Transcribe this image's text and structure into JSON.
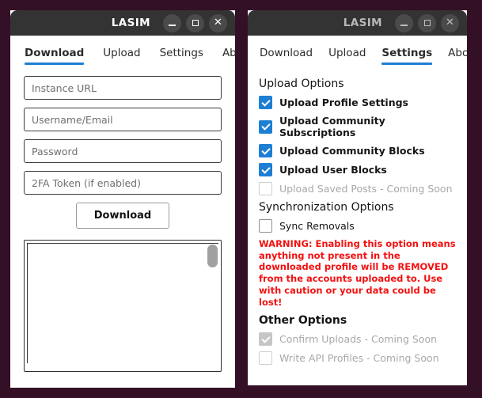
{
  "desktop": {
    "background_color": "#341026"
  },
  "download_window": {
    "titlebar": {
      "title": "LASIM",
      "minimize_label": "Minimize",
      "maximize_label": "Maximize",
      "close_label": "Close"
    },
    "tabs": [
      {
        "label": "Download",
        "active": true
      },
      {
        "label": "Upload",
        "active": false
      },
      {
        "label": "Settings",
        "active": false
      },
      {
        "label": "About",
        "active": false
      }
    ],
    "fields": [
      {
        "name": "instance-url",
        "placeholder": "Instance URL",
        "value": ""
      },
      {
        "name": "username-email",
        "placeholder": "Username/Email",
        "value": ""
      },
      {
        "name": "password",
        "placeholder": "Password",
        "value": ""
      },
      {
        "name": "twofa-token",
        "placeholder": "2FA Token (if enabled)",
        "value": ""
      }
    ],
    "download_button": "Download",
    "log_output": ""
  },
  "settings_window": {
    "titlebar": {
      "title": "LASIM",
      "minimize_label": "Minimize",
      "maximize_label": "Maximize",
      "close_label": "Close"
    },
    "tabs": [
      {
        "label": "Download",
        "active": false
      },
      {
        "label": "Upload",
        "active": false
      },
      {
        "label": "Settings",
        "active": true
      },
      {
        "label": "About",
        "active": false
      }
    ],
    "upload_options": {
      "title": "Upload Options",
      "items": [
        {
          "label": "Upload Profile Settings",
          "checked": true,
          "disabled": false
        },
        {
          "label": "Upload Community Subscriptions",
          "checked": true,
          "disabled": false
        },
        {
          "label": "Upload Community Blocks",
          "checked": true,
          "disabled": false
        },
        {
          "label": "Upload User Blocks",
          "checked": true,
          "disabled": false
        },
        {
          "label": "Upload Saved Posts - Coming Soon",
          "checked": false,
          "disabled": true
        }
      ]
    },
    "sync_options": {
      "title": "Synchronization Options",
      "items": [
        {
          "label": "Sync Removals",
          "checked": false,
          "disabled": false
        }
      ],
      "warning": "WARNING: Enabling this option means anything not present in the downloaded profile will be REMOVED from the accounts uploaded to. Use with caution or your data could be lost!",
      "warning_color": "#f41010"
    },
    "other_options": {
      "title": "Other Options",
      "items": [
        {
          "label": "Confirm Uploads - Coming Soon",
          "checked": true,
          "disabled": true
        },
        {
          "label": "Write API Profiles - Coming Soon",
          "checked": false,
          "disabled": true
        }
      ]
    }
  },
  "colors": {
    "accent": "#1d7fd4",
    "titlebar": "#333333",
    "warning": "#f41010"
  }
}
